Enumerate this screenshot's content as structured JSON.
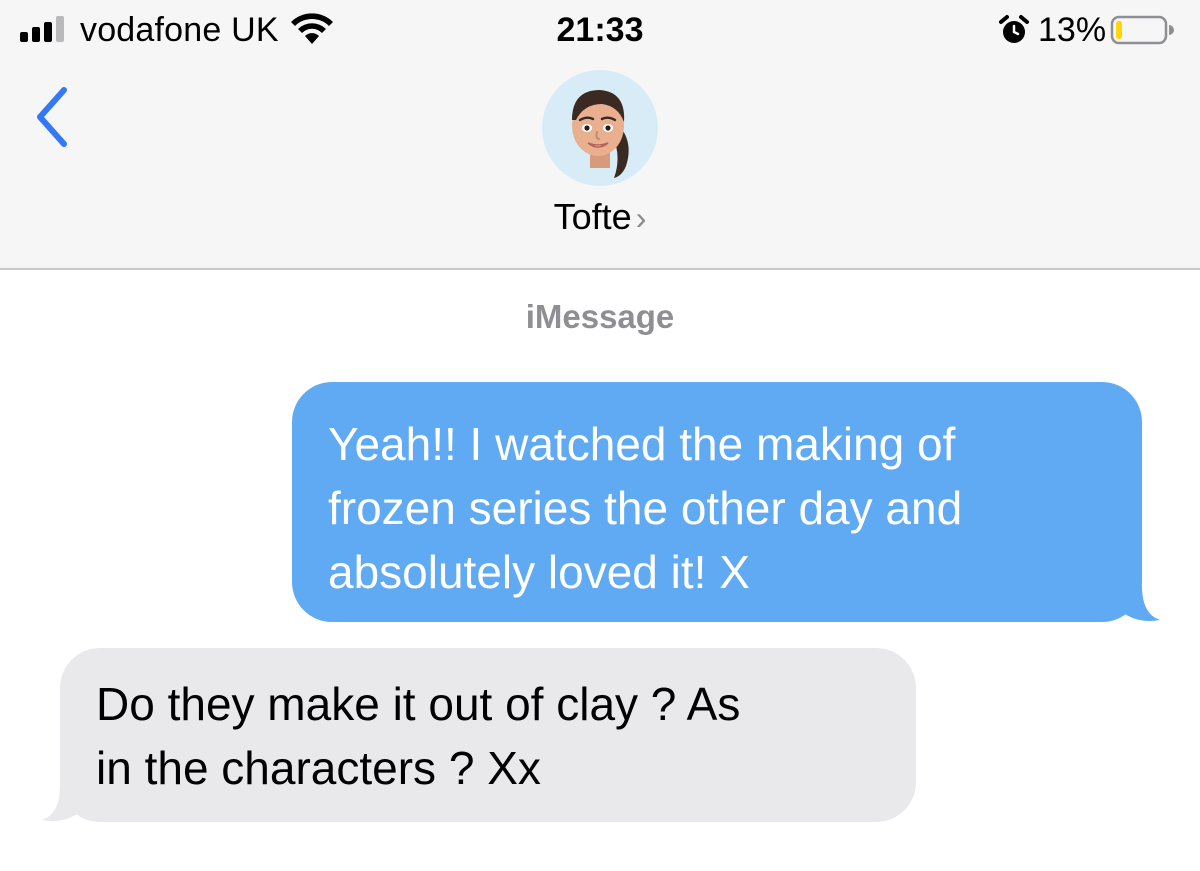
{
  "status_bar": {
    "carrier": "vodafone UK",
    "time": "21:33",
    "battery_percent": "13%",
    "signal_bars": 3,
    "signal_bars_total": 4,
    "battery_level": 0.13,
    "icons": [
      "signal-icon",
      "wifi-icon",
      "alarm-icon",
      "battery-icon"
    ]
  },
  "nav": {
    "back_icon": "chevron-left-icon",
    "contact_name": "Tofte",
    "contact_chevron": "›",
    "avatar": "memoji-avatar"
  },
  "conversation": {
    "service_label": "iMessage",
    "messages": [
      {
        "direction": "sent",
        "lines": [
          "Yeah!! I watched the making of",
          "frozen series the other day and",
          "absolutely loved it! X"
        ]
      },
      {
        "direction": "received",
        "lines": [
          "Do they make it out of clay ? As",
          "in the characters ? Xx"
        ]
      }
    ]
  },
  "colors": {
    "sent_bubble": "#5faaf3",
    "received_bubble": "#e9e9eb",
    "accent": "#3478f6",
    "header_bg": "#f6f6f7",
    "battery_low": "#ffd60a"
  }
}
